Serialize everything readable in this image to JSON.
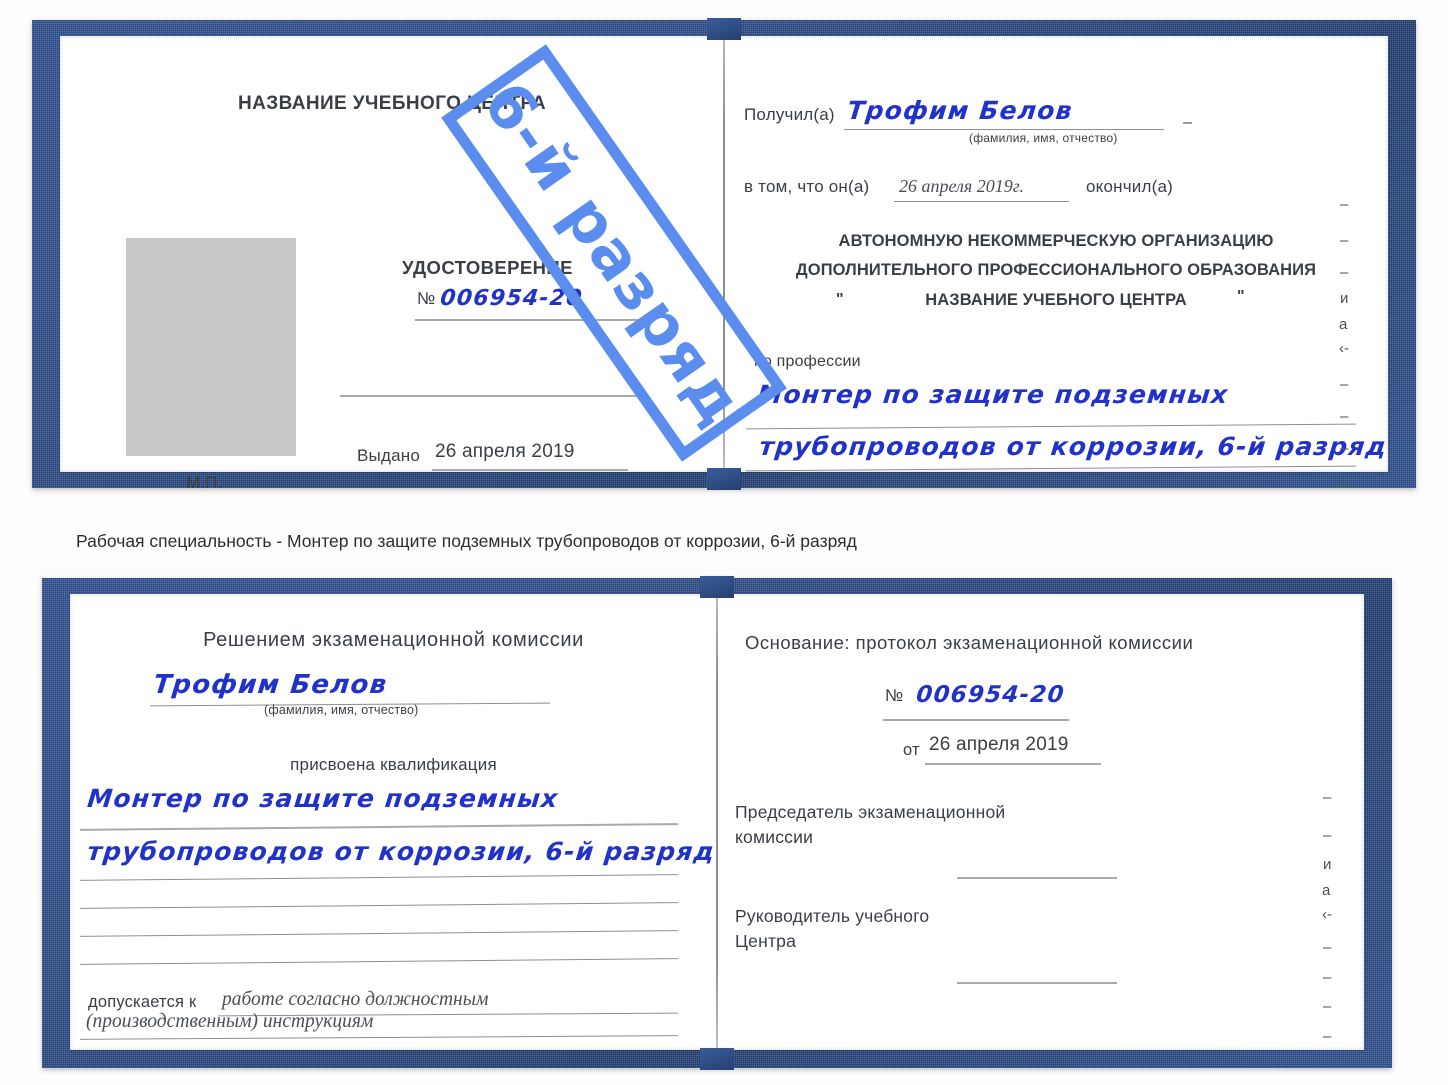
{
  "caption": {
    "text": "Рабочая специальность - Монтер по защите подземных трубопроводов от коррозии, 6-й разряд"
  },
  "watermark": {
    "label": "6-й разряд",
    "color": "#5b8def"
  },
  "colors": {
    "cover_blue": "#2a4a86",
    "handwriting_blue": "#2132c8",
    "printed_gray": "#3a3f45",
    "photo_placeholder": "#c9c9c9",
    "rule_gray": "#8d8f92"
  },
  "certificate_top": {
    "left_page": {
      "heading": "НАЗВАНИЕ УЧЕБНОГО ЦЕНТРА",
      "doc_title": "УДОСТОВЕРЕНИЕ",
      "number_label": "№",
      "number_value": "006954-20",
      "issued_label": "Выдано",
      "issued_value": "26 апреля 2019",
      "seal_label": "М.П.",
      "photo_placeholder_alt": "photo-area"
    },
    "right_page": {
      "received_label": "Получил(а)",
      "received_value": "Трофим Белов",
      "received_hint": "(фамилия, имя, отчество)",
      "that_label": "в том, что он(а)",
      "that_value": "26 апреля 2019г.",
      "finished_label": "окончил(а)",
      "org_line1": "АВТОНОМНУЮ НЕКОММЕРЧЕСКУЮ ОРГАНИЗАЦИЮ",
      "org_line2": "ДОПОЛНИТЕЛЬНОГО ПРОФЕССИОНАЛЬНОГО ОБРАЗОВАНИЯ",
      "org_quote_open": "\"",
      "org_line3": "НАЗВАНИЕ УЧЕБНОГО ЦЕНТРА",
      "org_quote_close": "\"",
      "profession_label": "по профессии",
      "profession_line1": "Монтер по защите подземных",
      "profession_line2": "трубопроводов от коррозии, 6-й разряд",
      "edge_fragments": [
        "–",
        "–",
        "–",
        "и",
        "а",
        "‹-",
        "–",
        "–",
        "–",
        "–"
      ]
    }
  },
  "certificate_bottom": {
    "left_page": {
      "heading": "Решением экзаменационной комиссии",
      "name_value": "Трофим Белов",
      "name_hint": "(фамилия, имя, отчество)",
      "qualification_label": "присвоена квалификация",
      "qualification_line1": "Монтер по защите подземных",
      "qualification_line2": "трубопроводов от коррозии, 6-й разряд",
      "admitted_label": "допускается к",
      "admitted_value_line1": "работе согласно должностным",
      "admitted_value_line2": "(производственным) инструкциям"
    },
    "right_page": {
      "basis_label": "Основание: протокол экзаменационной комиссии",
      "number_label": "№",
      "number_value": "006954-20",
      "date_label": "от",
      "date_value": "26 апреля 2019",
      "chairman_line1": "Председатель экзаменационной",
      "chairman_line2": "комиссии",
      "head_line1": "Руководитель учебного",
      "head_line2": "Центра",
      "edge_fragments": [
        "–",
        "–",
        "и",
        "а",
        "‹-",
        "–",
        "–",
        "–",
        "–"
      ]
    }
  }
}
